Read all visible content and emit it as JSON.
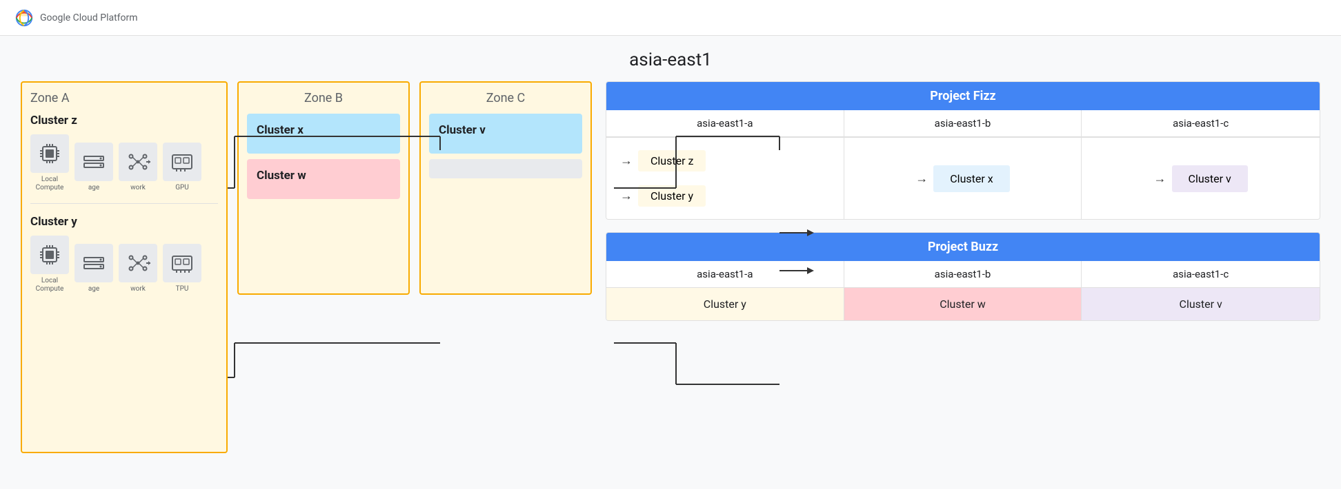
{
  "topbar": {
    "logo_text": "Google Cloud Platform"
  },
  "region": {
    "title": "asia-east1"
  },
  "zones": {
    "zone_a": {
      "label": "Zone A",
      "cluster_z": {
        "label": "Cluster z",
        "icons": [
          {
            "name": "Local Compute",
            "type": "compute"
          },
          {
            "name": "age",
            "type": "storage"
          },
          {
            "name": "work",
            "type": "network"
          },
          {
            "name": "GPU",
            "type": "gpu"
          }
        ]
      },
      "cluster_y": {
        "label": "Cluster y",
        "icons": [
          {
            "name": "Local Compute",
            "type": "compute"
          },
          {
            "name": "age",
            "type": "storage"
          },
          {
            "name": "work",
            "type": "network"
          },
          {
            "name": "TPU",
            "type": "tpu"
          }
        ]
      }
    },
    "zone_b": {
      "label": "Zone B",
      "cluster_x": {
        "label": "Cluster x",
        "color": "blue"
      },
      "cluster_w": {
        "label": "Cluster w",
        "color": "red"
      }
    },
    "zone_c": {
      "label": "Zone C",
      "cluster_v": {
        "label": "Cluster v",
        "color": "blue"
      },
      "cluster_v2": {
        "label": "",
        "color": "gray"
      }
    }
  },
  "project_fizz": {
    "title": "Project Fizz",
    "zones": [
      "asia-east1-a",
      "asia-east1-b",
      "asia-east1-c"
    ],
    "zone_a_clusters": [
      "Cluster z",
      "Cluster y"
    ],
    "zone_b_cluster": "Cluster x",
    "zone_c_cluster": "Cluster v",
    "arrow1": "→",
    "arrow2": "→"
  },
  "project_buzz": {
    "title": "Project Buzz",
    "zones": [
      "asia-east1-a",
      "asia-east1-b",
      "asia-east1-c"
    ],
    "cluster_y": "Cluster y",
    "cluster_w": "Cluster w",
    "cluster_v": "Cluster v"
  }
}
